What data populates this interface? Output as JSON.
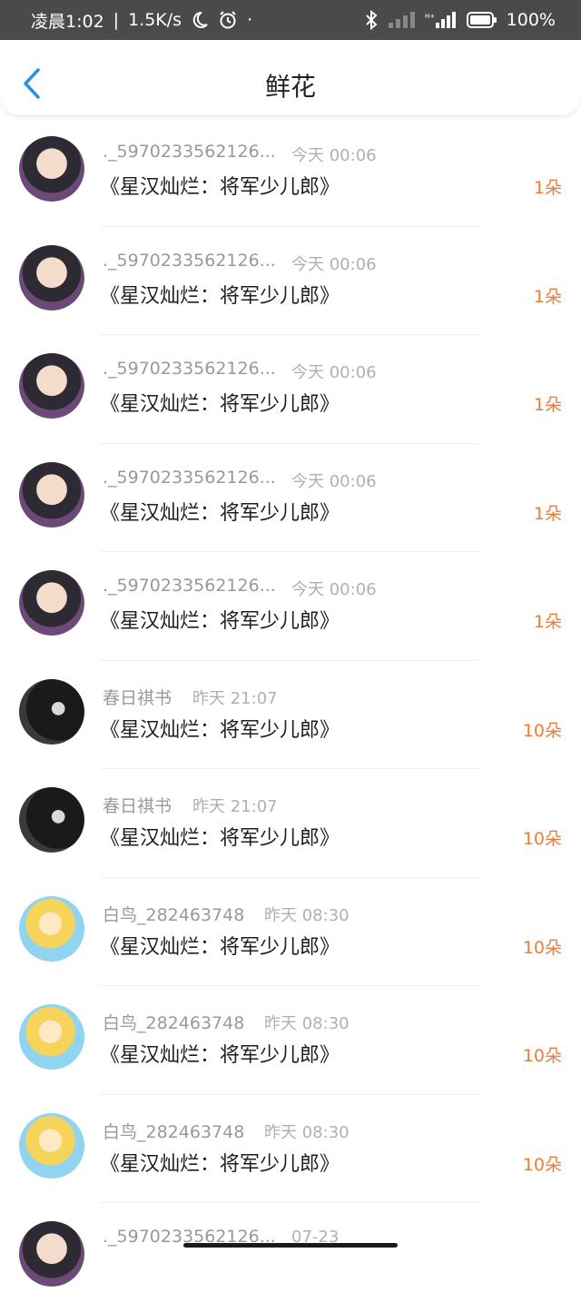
{
  "status_bar": {
    "time": "凌晨1:02",
    "net_speed": "1.5K/s",
    "battery": "100%",
    "icons": [
      "moon-icon",
      "alarm-icon",
      "bluetooth-icon",
      "signal-icon",
      "battery-icon"
    ]
  },
  "header": {
    "title": "鲜花",
    "back_icon": "chevron-left-icon"
  },
  "colors": {
    "accent_blue": "#2f8fe6",
    "count_orange": "#ee7d38",
    "name_gray": "#999999"
  },
  "items": [
    {
      "name": "._5970233562126...",
      "time": "今天 00:06",
      "book": "《星汉灿烂：将军少儿郎》",
      "count": "1朵",
      "avatar": "girl"
    },
    {
      "name": "._5970233562126...",
      "time": "今天 00:06",
      "book": "《星汉灿烂：将军少儿郎》",
      "count": "1朵",
      "avatar": "girl"
    },
    {
      "name": "._5970233562126...",
      "time": "今天 00:06",
      "book": "《星汉灿烂：将军少儿郎》",
      "count": "1朵",
      "avatar": "girl"
    },
    {
      "name": "._5970233562126...",
      "time": "今天 00:06",
      "book": "《星汉灿烂：将军少儿郎》",
      "count": "1朵",
      "avatar": "girl"
    },
    {
      "name": "._5970233562126...",
      "time": "今天 00:06",
      "book": "《星汉灿烂：将军少儿郎》",
      "count": "1朵",
      "avatar": "girl"
    },
    {
      "name": "春日祺书",
      "time": "昨天 21:07",
      "book": "《星汉灿烂：将军少儿郎》",
      "count": "10朵",
      "avatar": "dark"
    },
    {
      "name": "春日祺书",
      "time": "昨天 21:07",
      "book": "《星汉灿烂：将军少儿郎》",
      "count": "10朵",
      "avatar": "dark"
    },
    {
      "name": "白鸟_282463748",
      "time": "昨天 08:30",
      "book": "《星汉灿烂：将军少儿郎》",
      "count": "10朵",
      "avatar": "anime"
    },
    {
      "name": "白鸟_282463748",
      "time": "昨天 08:30",
      "book": "《星汉灿烂：将军少儿郎》",
      "count": "10朵",
      "avatar": "anime"
    },
    {
      "name": "白鸟_282463748",
      "time": "昨天 08:30",
      "book": "《星汉灿烂：将军少儿郎》",
      "count": "10朵",
      "avatar": "anime"
    },
    {
      "name": "._5970233562126...",
      "time": "07-23",
      "book": "",
      "count": "",
      "avatar": "girl"
    }
  ]
}
